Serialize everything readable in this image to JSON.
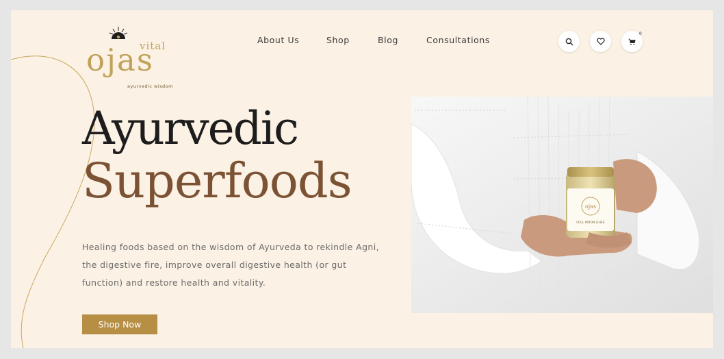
{
  "brand": {
    "name": "ojas",
    "prefix": "vital",
    "tagline": "ayurvedic wisdom"
  },
  "nav": {
    "items": [
      {
        "label": "About Us"
      },
      {
        "label": "Shop"
      },
      {
        "label": "Blog"
      },
      {
        "label": "Consultations"
      }
    ]
  },
  "header_icons": {
    "search": "search-icon",
    "wishlist": "heart-icon",
    "cart": "cart-icon",
    "cart_count": "0"
  },
  "hero": {
    "headline_line1": "Ayurvedic",
    "headline_line2": "Superfoods",
    "description": "Healing foods based on the wisdom of Ayurveda to rekindle Agni, the digestive fire, improve overall digestive health (or gut function) and restore health and vitality.",
    "cta_label": "Shop Now"
  },
  "product_image": {
    "jar_brand": "ojas",
    "jar_label": "FULL MOON GHEE"
  },
  "colors": {
    "background": "#fbf1e4",
    "accent_gold": "#b68f45",
    "headline_dark": "#1d1d1d",
    "headline_brown": "#7b5334"
  }
}
